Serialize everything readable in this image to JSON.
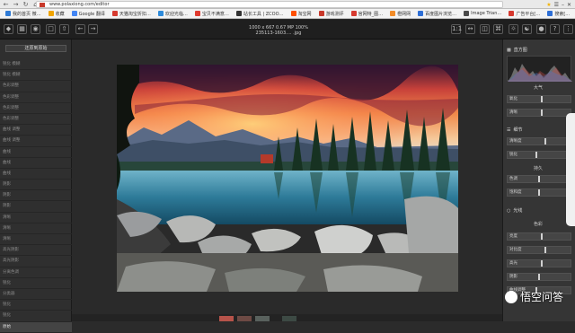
{
  "browser": {
    "url": "www.polaxiong.com/editor",
    "nav_icons": [
      "back-icon",
      "forward-icon",
      "reload-icon",
      "home-icon"
    ],
    "bookmarks": [
      {
        "label": "我的首页 微…",
        "color": "#2f7bd6"
      },
      {
        "label": "收藏",
        "color": "#f0a400"
      },
      {
        "label": "Google 翻译",
        "color": "#4285f4"
      },
      {
        "label": "天猫淘宝折扣…",
        "color": "#d63a2f"
      },
      {
        "label": "欢迎光临…",
        "color": "#2e8bdb"
      },
      {
        "label": "宝贝不满意…",
        "color": "#e03b2f"
      },
      {
        "label": "站长工具 | ZCOO…",
        "color": "#333333"
      },
      {
        "label": "淘宝网",
        "color": "#ff5000"
      },
      {
        "label": "游戏测评",
        "color": "#c8392b"
      },
      {
        "label": "官网特_图…",
        "color": "#d63a2f"
      },
      {
        "label": "橙网网",
        "color": "#f28c28"
      },
      {
        "label": "百度图片浏览…",
        "color": "#2e6fd6"
      },
      {
        "label": "Image Trian…",
        "color": "#4a4a4a"
      },
      {
        "label": "广告平台[…",
        "color": "#d6392f"
      },
      {
        "label": "搜索[…",
        "color": "#2e6fd6"
      }
    ]
  },
  "topbar": {
    "image_info_line1": "1000 x 667  0.67 MP  100%",
    "image_info_line2": "235113-1603.... .jpg",
    "zoom_label": "1:1"
  },
  "left_panel": {
    "original_button": "还原到原始",
    "history_items": [
      "锐化 模糊",
      "锐化 模糊",
      "色彩调整",
      "色彩调整",
      "色彩调整",
      "色彩调整",
      "曲线 调整",
      "曲线 调整",
      "曲线",
      "曲线",
      "曲线",
      "阴影",
      "阴影",
      "阴影",
      "清晰",
      "清晰",
      "清晰",
      "高光阴影",
      "高光阴影",
      "分离色调",
      "锐化",
      "分类器",
      "锐化",
      "锐化",
      "原始"
    ]
  },
  "right_panel": {
    "histogram_title": "直方图",
    "basic_title": "大气",
    "section_detail": "细节",
    "section_effects": "持久",
    "section_light": "光线",
    "section_color": "色彩",
    "sliders": [
      {
        "label": "氧化",
        "value": 0.55
      },
      {
        "label": "清晰",
        "value": 0.55
      },
      {
        "label": "清晰度",
        "value": 0.6
      },
      {
        "label": "锐化",
        "value": 0.45
      },
      {
        "label": "色调",
        "value": 0.5
      },
      {
        "label": "饱和度",
        "value": 0.5
      },
      {
        "label": "亮度",
        "value": 0.55
      },
      {
        "label": "对比度",
        "value": 0.6
      },
      {
        "label": "高光",
        "value": 0.55
      },
      {
        "label": "阴影",
        "value": 0.5
      },
      {
        "label": "曲线调整",
        "value": 0.45
      }
    ]
  },
  "watermark": {
    "text": "悟空问答"
  },
  "colors": {
    "panel_bg": "#2f2f2f",
    "canvas_bg": "#2a2a2a",
    "right_panel_bg": "#353535"
  }
}
